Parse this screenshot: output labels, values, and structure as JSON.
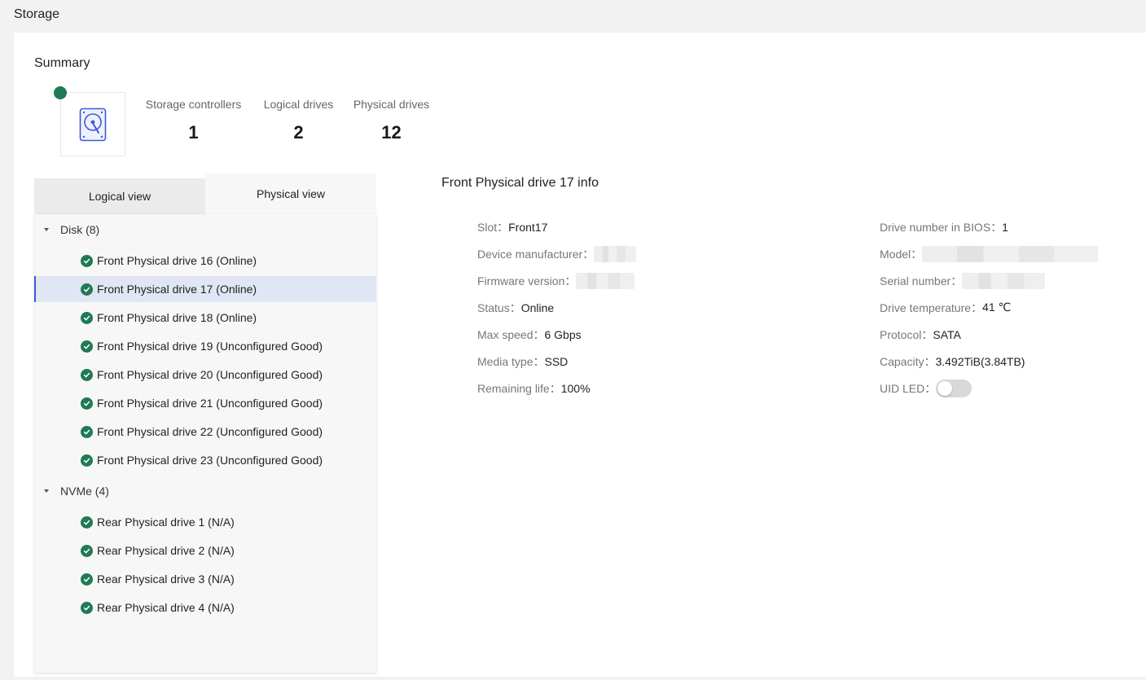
{
  "page": {
    "title": "Storage"
  },
  "summary": {
    "title": "Summary",
    "stats": [
      {
        "label": "Storage controllers",
        "value": "1"
      },
      {
        "label": "Logical drives",
        "value": "2"
      },
      {
        "label": "Physical drives",
        "value": "12"
      }
    ]
  },
  "tabs": {
    "logical": "Logical view",
    "physical": "Physical view",
    "active": "physical"
  },
  "tree": {
    "groups": [
      {
        "label": "Disk (8)",
        "items": [
          "Front Physical drive 16 (Online)",
          "Front Physical drive 17 (Online)",
          "Front Physical drive 18 (Online)",
          "Front Physical drive 19 (Unconfigured Good)",
          "Front Physical drive 20 (Unconfigured Good)",
          "Front Physical drive 21 (Unconfigured Good)",
          "Front Physical drive 22 (Unconfigured Good)",
          "Front Physical drive 23 (Unconfigured Good)"
        ]
      },
      {
        "label": "NVMe (4)",
        "items": [
          "Rear Physical drive 1 (N/A)",
          "Rear Physical drive 2 (N/A)",
          "Rear Physical drive 3 (N/A)",
          "Rear Physical drive 4 (N/A)"
        ]
      }
    ],
    "selected": "Front Physical drive 17 (Online)"
  },
  "info": {
    "title": "Front Physical drive 17 info",
    "left": [
      {
        "key": "Slot",
        "value": "Front17"
      },
      {
        "key": "Device manufacturer",
        "value": ""
      },
      {
        "key": "Firmware version",
        "value": ""
      },
      {
        "key": "Status",
        "value": "Online"
      },
      {
        "key": "Max speed",
        "value": "6 Gbps"
      },
      {
        "key": "Media type",
        "value": "SSD"
      },
      {
        "key": "Remaining life",
        "value": "100%"
      }
    ],
    "right": [
      {
        "key": "Drive number in BIOS",
        "value": "1"
      },
      {
        "key": "Model",
        "value": ""
      },
      {
        "key": "Serial number",
        "value": ""
      },
      {
        "key": "Drive temperature",
        "value": "41 ℃"
      },
      {
        "key": "Protocol",
        "value": "SATA"
      },
      {
        "key": "Capacity",
        "value": "3.492TiB(3.84TB)"
      },
      {
        "key": "UID LED",
        "value": ""
      }
    ],
    "uid_led_on": false
  },
  "colors": {
    "ok": "#1f7a55",
    "accent": "#3a5bd9",
    "selected_bg": "#e1e6f5"
  }
}
